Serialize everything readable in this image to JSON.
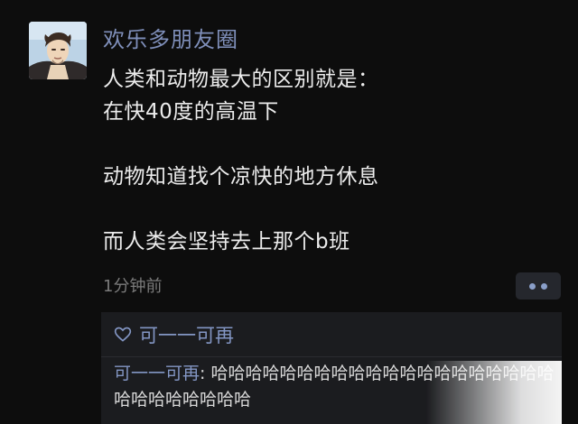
{
  "post": {
    "username": "欢乐多朋友圈",
    "avatar_icon": "cartoon-man-avatar",
    "content_lines": [
      "人类和动物最大的区别就是：",
      "在快40度的高温下",
      "",
      "动物知道找个凉快的地方休息",
      "",
      "而人类会坚持去上那个b班"
    ],
    "timestamp": "1分钟前",
    "more_icon": "more-dots-icon"
  },
  "interactions": {
    "like_icon": "heart-outline-icon",
    "likes": "可一一可再",
    "comment": {
      "author": "可一一可再",
      "separator": ": ",
      "text": "哈哈哈哈哈哈哈哈哈哈哈哈哈哈哈哈哈哈哈哈哈哈哈哈哈哈哈哈"
    }
  },
  "colors": {
    "background": "#0d0d0d",
    "name_blue": "#7f8fba",
    "link_blue": "#8396c4",
    "panel": "#1b1c1f"
  }
}
